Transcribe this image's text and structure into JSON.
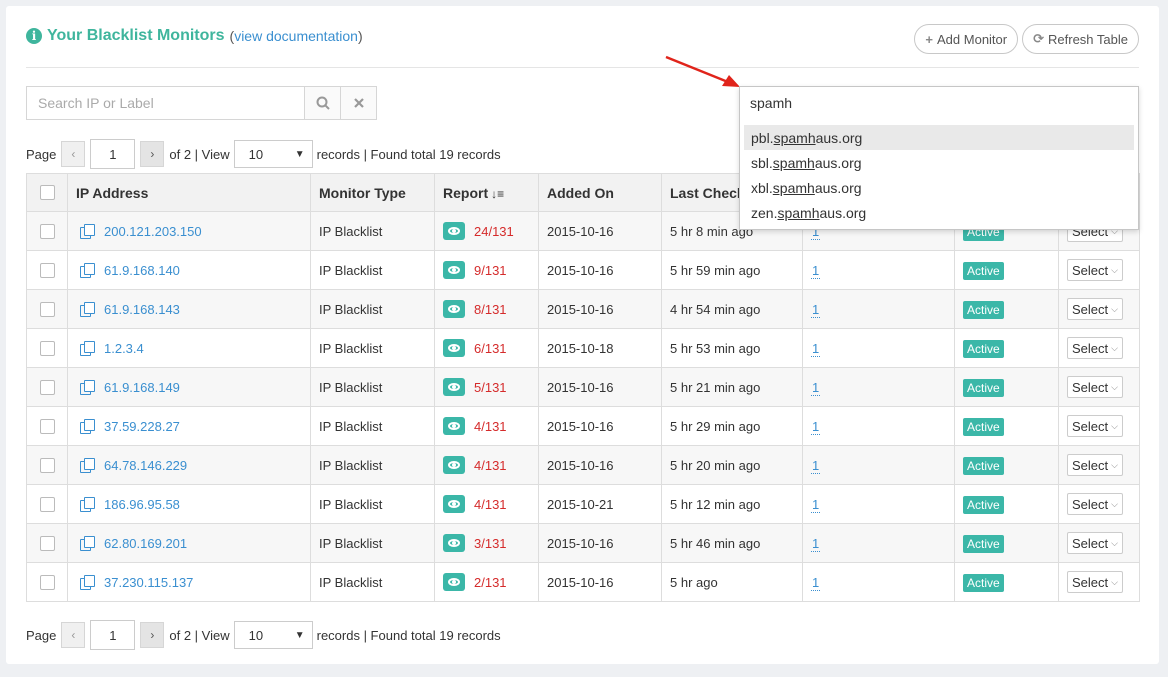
{
  "header": {
    "title": "Your Blacklist Monitors",
    "docs_prefix": "(",
    "docs_link": "view documentation",
    "docs_suffix": ")",
    "add_monitor": "Add Monitor",
    "refresh_table": "Refresh Table"
  },
  "search": {
    "placeholder": "Search IP or Label"
  },
  "pager": {
    "page_label": "Page",
    "page_value": "1",
    "of_text": "of 2 | View",
    "view_value": "10",
    "records_text": "records | Found total 19 records"
  },
  "table": {
    "headers": [
      "IP Address",
      "Monitor Type",
      "Report",
      "Added On",
      "Last Check"
    ],
    "rows": [
      {
        "ip": "200.121.203.150",
        "type": "IP Blacklist",
        "report": "24/131",
        "added": "2015-10-16",
        "last": "5 hr 8 min ago",
        "count": "1",
        "status": "Active",
        "action": "Select"
      },
      {
        "ip": "61.9.168.140",
        "type": "IP Blacklist",
        "report": "9/131",
        "added": "2015-10-16",
        "last": "5 hr 59 min ago",
        "count": "1",
        "status": "Active",
        "action": "Select"
      },
      {
        "ip": "61.9.168.143",
        "type": "IP Blacklist",
        "report": "8/131",
        "added": "2015-10-16",
        "last": "4 hr 54 min ago",
        "count": "1",
        "status": "Active",
        "action": "Select"
      },
      {
        "ip": "1.2.3.4",
        "type": "IP Blacklist",
        "report": "6/131",
        "added": "2015-10-18",
        "last": "5 hr 53 min ago",
        "count": "1",
        "status": "Active",
        "action": "Select"
      },
      {
        "ip": "61.9.168.149",
        "type": "IP Blacklist",
        "report": "5/131",
        "added": "2015-10-16",
        "last": "5 hr 21 min ago",
        "count": "1",
        "status": "Active",
        "action": "Select"
      },
      {
        "ip": "37.59.228.27",
        "type": "IP Blacklist",
        "report": "4/131",
        "added": "2015-10-16",
        "last": "5 hr 29 min ago",
        "count": "1",
        "status": "Active",
        "action": "Select"
      },
      {
        "ip": "64.78.146.229",
        "type": "IP Blacklist",
        "report": "4/131",
        "added": "2015-10-16",
        "last": "5 hr 20 min ago",
        "count": "1",
        "status": "Active",
        "action": "Select"
      },
      {
        "ip": "186.96.95.58",
        "type": "IP Blacklist",
        "report": "4/131",
        "added": "2015-10-21",
        "last": "5 hr 12 min ago",
        "count": "1",
        "status": "Active",
        "action": "Select"
      },
      {
        "ip": "62.80.169.201",
        "type": "IP Blacklist",
        "report": "3/131",
        "added": "2015-10-16",
        "last": "5 hr 46 min ago",
        "count": "1",
        "status": "Active",
        "action": "Select"
      },
      {
        "ip": "37.230.115.137",
        "type": "IP Blacklist",
        "report": "2/131",
        "added": "2015-10-16",
        "last": "5 hr ago",
        "count": "1",
        "status": "Active",
        "action": "Select"
      }
    ]
  },
  "autocomplete": {
    "query": "spamh",
    "items": [
      {
        "pre": "pbl.",
        "match": "spamh",
        "post": "aus.org"
      },
      {
        "pre": "sbl.",
        "match": "spamh",
        "post": "aus.org"
      },
      {
        "pre": "xbl.",
        "match": "spamh",
        "post": "aus.org"
      },
      {
        "pre": "zen.",
        "match": "spamh",
        "post": "aus.org"
      }
    ]
  },
  "colors": {
    "accent": "#3fb59d",
    "link": "#3a8fd0",
    "danger": "#d52b2b",
    "arrow": "#e0241b"
  }
}
